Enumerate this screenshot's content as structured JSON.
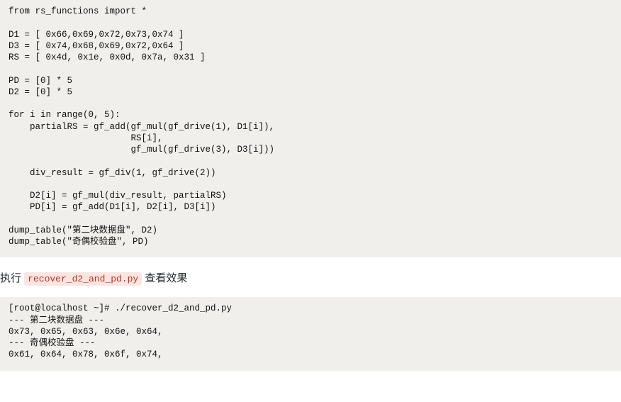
{
  "code_block_1": "from rs_functions import *\n\nD1 = [ 0x66,0x69,0x72,0x73,0x74 ]\nD3 = [ 0x74,0x68,0x69,0x72,0x64 ]\nRS = [ 0x4d, 0x1e, 0x0d, 0x7a, 0x31 ]\n\nPD = [0] * 5\nD2 = [0] * 5\n\nfor i in range(0, 5):\n    partialRS = gf_add(gf_mul(gf_drive(1), D1[i]),\n                       RS[i],\n                       gf_mul(gf_drive(3), D3[i]))\n\n    div_result = gf_div(1, gf_drive(2))\n\n    D2[i] = gf_mul(div_result, partialRS)\n    PD[i] = gf_add(D1[i], D2[i], D3[i])\n\ndump_table(\"第二块数据盘\", D2)\ndump_table(\"奇偶校验盘\", PD)",
  "description": {
    "prefix": "执行 ",
    "code": "recover_d2_and_pd.py",
    "suffix": " 查看效果"
  },
  "code_block_2": "[root@localhost ~]# ./recover_d2_and_pd.py\n--- 第二块数据盘 ---\n0x73, 0x65, 0x63, 0x6e, 0x64,\n--- 奇偶校验盘 ---\n0x61, 0x64, 0x78, 0x6f, 0x74,\n"
}
